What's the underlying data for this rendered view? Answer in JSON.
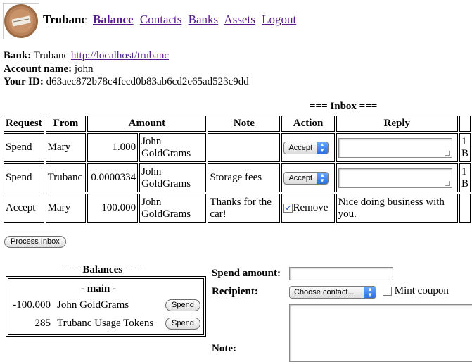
{
  "header": {
    "brand": "Trubanc",
    "nav": [
      {
        "label": "Balance",
        "active": true
      },
      {
        "label": "Contacts",
        "active": false
      },
      {
        "label": "Banks",
        "active": false
      },
      {
        "label": "Assets",
        "active": false
      },
      {
        "label": "Logout",
        "active": false
      }
    ]
  },
  "info": {
    "bank_label": "Bank:",
    "bank_name": "Trubanc",
    "bank_url": "http://localhost/trubanc",
    "account_label": "Account name:",
    "account_name": "john",
    "id_label": "Your ID:",
    "id_value": "d63aec872b78c4fecd0b83ab6cd2e65ad523c9dd"
  },
  "inbox": {
    "title": "=== Inbox ===",
    "headers": [
      "Request",
      "From",
      "Amount",
      "Note",
      "Action",
      "Reply"
    ],
    "rows": [
      {
        "request": "Spend",
        "from": "Mary",
        "amount": "1.000",
        "asset": "John GoldGrams",
        "note": "",
        "action": "Accept",
        "reply": "",
        "extra": "1 B"
      },
      {
        "request": "Spend",
        "from": "Trubanc",
        "amount": "0.0000334",
        "asset": "John GoldGrams",
        "note": "Storage fees",
        "action": "Accept",
        "reply": "",
        "extra": "1 B"
      },
      {
        "request": "Accept",
        "from": "Mary",
        "amount": "100.000",
        "asset": "John GoldGrams",
        "note": "Thanks for the car!",
        "action": "Remove",
        "reply": "Nice doing business with you.",
        "extra": ""
      }
    ],
    "process_button": "Process Inbox"
  },
  "balances": {
    "title": "=== Balances ===",
    "account": "- main -",
    "rows": [
      {
        "amount": "-100.000",
        "asset": "John GoldGrams",
        "button": "Spend"
      },
      {
        "amount": "285",
        "asset": "Trubanc Usage Tokens",
        "button": "Spend"
      }
    ]
  },
  "spend_form": {
    "amount_label": "Spend amount:",
    "amount_value": "",
    "recipient_label": "Recipient:",
    "recipient_select": "Choose contact...",
    "mint_label": "Mint coupon",
    "note_label": "Note:"
  }
}
